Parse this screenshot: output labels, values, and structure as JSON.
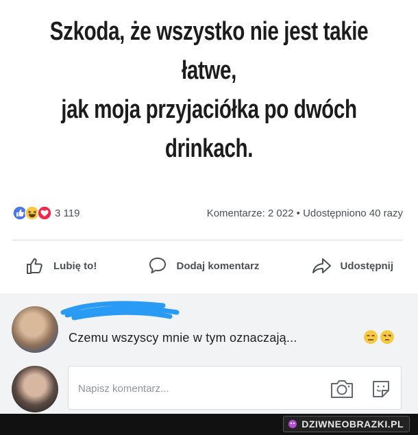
{
  "post": {
    "text_lines": [
      "Szkoda, że wszystko nie jest takie",
      "łatwe,",
      "jak moja przyjaciółka po dwóch",
      "drinkach."
    ]
  },
  "stats": {
    "reaction_count": "3 119",
    "comments": "Komentarze: 2 022",
    "separator": "•",
    "shares": "Udostępniono 40 razy",
    "reaction_icons": [
      "like-icon",
      "haha-icon",
      "love-icon"
    ]
  },
  "actions": {
    "like": "Lubię to!",
    "comment": "Dodaj komentarz",
    "share": "Udostępnij"
  },
  "comment": {
    "text": "Czemu wszyscy mnie w tym oznaczają...",
    "emojis": [
      "expressionless-face-icon",
      "unamused-face-icon"
    ]
  },
  "composer": {
    "placeholder": "Napisz komentarz..."
  },
  "watermark": {
    "label": "DZIWNEOBRAZKI.PL"
  },
  "colors": {
    "like_blue": "#4a76e8",
    "haha_yellow": "#f7c844",
    "love_red": "#f0284a",
    "scribble_blue": "#2a9bf5"
  }
}
